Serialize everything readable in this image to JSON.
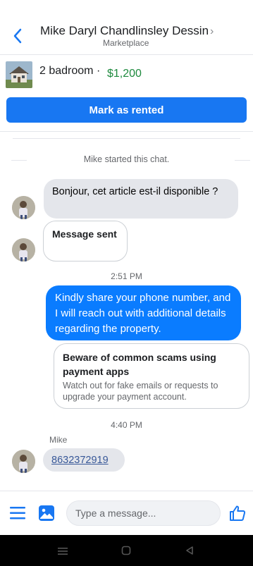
{
  "header": {
    "title": "Mike Daryl Chandlinsley Dessin",
    "subtitle": "Marketplace"
  },
  "listing": {
    "title": "2 badroom ·",
    "price": "$1,200",
    "action_label": "Mark as rented"
  },
  "chat": {
    "system_message": "Mike started this chat.",
    "incoming_first": "Bonjour, cet article est-il disponible ?",
    "message_sent_label": "Message sent",
    "time_1": "2:51 PM",
    "outgoing_1": "Kindly share your phone number, and I will reach out with additional details regarding the property.",
    "scam_warning_title": "Beware of common scams using payment apps",
    "scam_warning_body": "Watch out for fake emails or requests to upgrade your payment account.",
    "time_2": "4:40 PM",
    "sender_name": "Mike",
    "phone_number": "8632372919"
  },
  "composer": {
    "placeholder": "Type a message..."
  },
  "colors": {
    "accent": "#1877f2",
    "outgoing_bubble": "#0a7cff",
    "price": "#1e8a3e"
  },
  "icons": {
    "back": "chevron-left-icon",
    "menu": "menu-icon",
    "photo": "photo-icon",
    "like": "thumbs-up-icon"
  }
}
